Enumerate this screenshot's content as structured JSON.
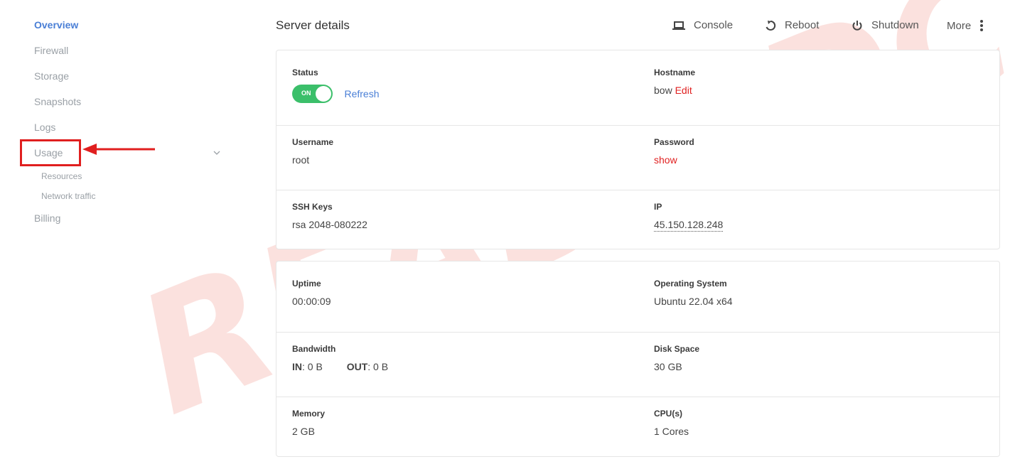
{
  "sidebar": {
    "items": [
      {
        "label": "Overview"
      },
      {
        "label": "Firewall"
      },
      {
        "label": "Storage"
      },
      {
        "label": "Snapshots"
      },
      {
        "label": "Logs"
      },
      {
        "label": "Usage"
      },
      {
        "label": "Billing"
      }
    ],
    "usage_sub": [
      {
        "label": "Resources"
      },
      {
        "label": "Network traffic"
      }
    ]
  },
  "header": {
    "title": "Server details",
    "actions": {
      "console": "Console",
      "reboot": "Reboot",
      "shutdown": "Shutdown",
      "more": "More"
    }
  },
  "details": {
    "status_label": "Status",
    "status_toggle": "ON",
    "refresh": "Refresh",
    "hostname_label": "Hostname",
    "hostname_value": "bow",
    "hostname_edit": "Edit",
    "username_label": "Username",
    "username_value": "root",
    "password_label": "Password",
    "password_show": "show",
    "ssh_label": "SSH Keys",
    "ssh_value": "rsa 2048-080222",
    "ip_label": "IP",
    "ip_value": "45.150.128.248"
  },
  "stats": {
    "uptime_label": "Uptime",
    "uptime_value": "00:00:09",
    "os_label": "Operating System",
    "os_value": "Ubuntu 22.04 x64",
    "bandwidth_label": "Bandwidth",
    "bw_in_label": "IN",
    "bw_in_value": ": 0 B",
    "bw_out_label": "OUT",
    "bw_out_value": ": 0 B",
    "disk_label": "Disk Space",
    "disk_value": "30 GB",
    "memory_label": "Memory",
    "memory_value": "2 GB",
    "cpu_label": "CPU(s)",
    "cpu_value": "1 Cores"
  },
  "watermark": "READYIDC",
  "colors": {
    "accent": "#4a7fd6",
    "toggle_on": "#3bbf6a",
    "highlight": "#e01f1f"
  }
}
